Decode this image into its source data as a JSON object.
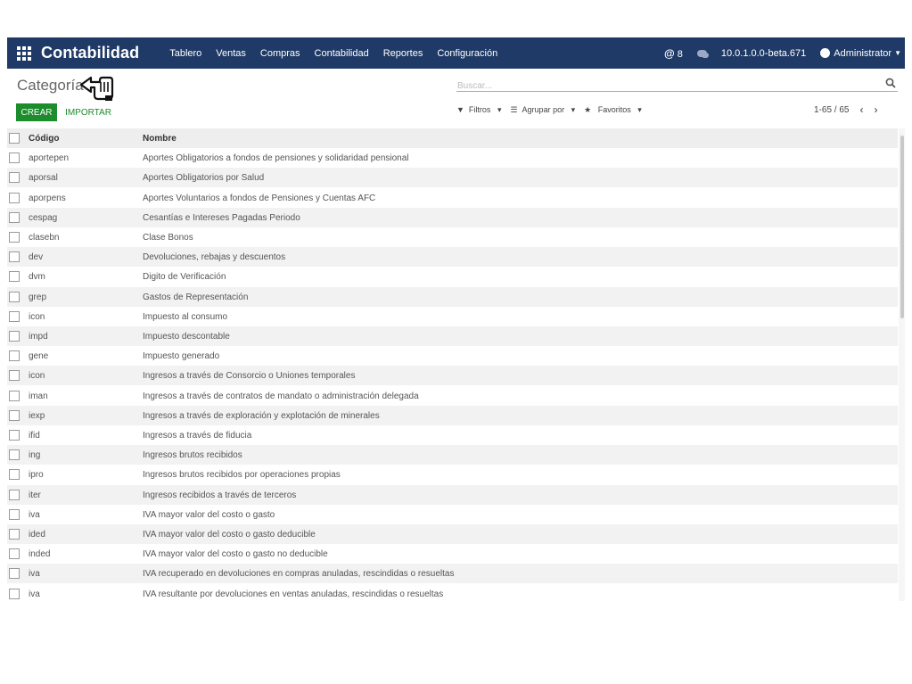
{
  "navbar": {
    "brand": "Contabilidad",
    "menu": [
      "Tablero",
      "Ventas",
      "Compras",
      "Contabilidad",
      "Reportes",
      "Configuración"
    ],
    "mentions_count": "8",
    "version": "10.0.1.0.0-beta.671",
    "user": "Administrator"
  },
  "breadcrumb": "Categoría",
  "buttons": {
    "create": "CREAR",
    "import": "IMPORTAR"
  },
  "search": {
    "placeholder": "Buscar..."
  },
  "filters": {
    "filters": "Filtros",
    "group_by": "Agrupar por",
    "favorites": "Favoritos"
  },
  "pager": {
    "range": "1-65 / 65"
  },
  "table": {
    "headers": {
      "code": "Código",
      "name": "Nombre"
    },
    "rows": [
      {
        "code": "aportepen",
        "name": "Aportes Obligatorios a fondos de pensiones y solidaridad pensional"
      },
      {
        "code": "aporsal",
        "name": "Aportes Obligatorios por Salud"
      },
      {
        "code": "aporpens",
        "name": "Aportes Voluntarios a fondos de Pensiones y Cuentas AFC"
      },
      {
        "code": "cespag",
        "name": "Cesantías e Intereses Pagadas Periodo"
      },
      {
        "code": "clasebn",
        "name": "Clase Bonos"
      },
      {
        "code": "dev",
        "name": "Devoluciones, rebajas y descuentos"
      },
      {
        "code": "dvm",
        "name": "Digito de Verificación"
      },
      {
        "code": "grep",
        "name": "Gastos de Representación"
      },
      {
        "code": "icon",
        "name": "Impuesto al consumo"
      },
      {
        "code": "impd",
        "name": "Impuesto descontable"
      },
      {
        "code": "gene",
        "name": "Impuesto generado"
      },
      {
        "code": "icon",
        "name": "Ingresos a través de Consorcio o Uniones temporales"
      },
      {
        "code": "iman",
        "name": "Ingresos a través de contratos de mandato o administración delegada"
      },
      {
        "code": "iexp",
        "name": "Ingresos a través de exploración y explotación de minerales"
      },
      {
        "code": "ifid",
        "name": "Ingresos a través de fiducia"
      },
      {
        "code": "ing",
        "name": "Ingresos brutos recibidos"
      },
      {
        "code": "ipro",
        "name": "Ingresos brutos recibidos por operaciones propias"
      },
      {
        "code": "iter",
        "name": "Ingresos recibidos a través de terceros"
      },
      {
        "code": "iva",
        "name": "IVA mayor valor del costo o gasto"
      },
      {
        "code": "ided",
        "name": "IVA mayor valor del costo o gasto deducible"
      },
      {
        "code": "inded",
        "name": "IVA mayor valor del costo o gasto no deducible"
      },
      {
        "code": "iva",
        "name": "IVA recuperado en devoluciones en compras anuladas, rescindidas o resueltas"
      },
      {
        "code": "iva",
        "name": "IVA resultante por devoluciones en ventas anuladas, rescindidas o resueltas"
      }
    ]
  },
  "colors": {
    "navbar": "#1f3a66",
    "primary": "#1c8c2c"
  }
}
